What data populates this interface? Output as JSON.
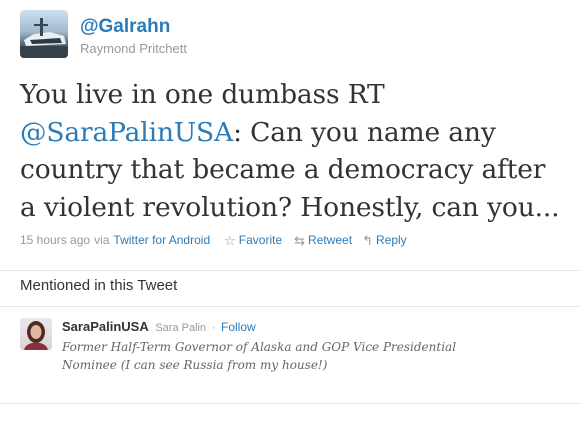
{
  "author": {
    "handle": "@Galrahn",
    "name": "Raymond Pritchett"
  },
  "tweet": {
    "text_before": "You live in one dumbass RT ",
    "mention": "@SaraPalinUSA",
    "text_after": ": Can you name any country that became a democracy after a violent revolution? Honestly, can you..."
  },
  "meta": {
    "time": "15 hours ago",
    "via": "via",
    "source": "Twitter for Android",
    "actions": {
      "favorite": "Favorite",
      "retweet": "Retweet",
      "reply": "Reply"
    },
    "icons": {
      "favorite": "star-icon",
      "retweet": "retweet-icon",
      "reply": "reply-icon"
    }
  },
  "mentioned": {
    "title": "Mentioned in this Tweet",
    "users": [
      {
        "handle": "SaraPalinUSA",
        "name": "Sara Palin",
        "separator": "·",
        "follow_label": "Follow",
        "bio": "Former Half-Term Governor of Alaska and GOP Vice Presidential Nominee (I can see Russia from my house!)"
      }
    ]
  },
  "colors": {
    "link": "#2b7bb9",
    "muted": "#999999",
    "text": "#333333"
  }
}
